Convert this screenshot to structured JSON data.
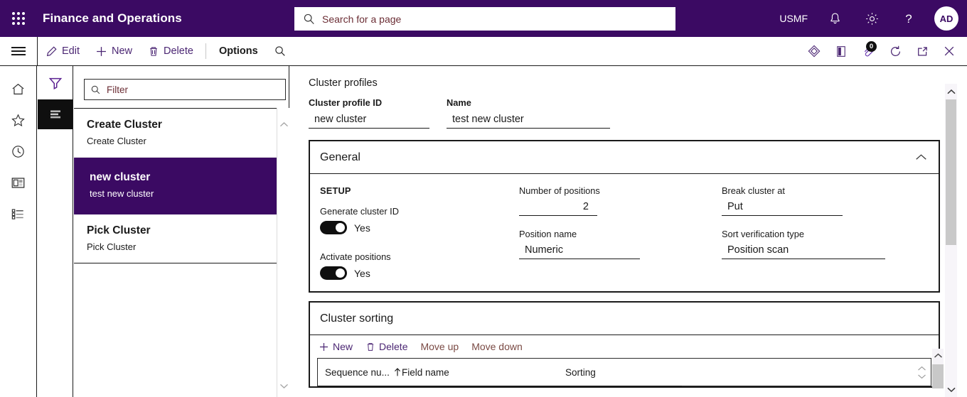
{
  "topbar": {
    "waffle_icon": "app-launcher-icon",
    "app_title": "Finance and Operations",
    "search": {
      "icon": "search-icon",
      "placeholder": "Search for a page",
      "value": ""
    },
    "company": "USMF",
    "icons": [
      "notifications-bell-icon",
      "settings-gear-icon",
      "help-question-icon"
    ],
    "avatar_initials": "AD"
  },
  "commandbar": {
    "menu_icon": "hamburger-menu-icon",
    "buttons": [
      {
        "label": "Edit",
        "icon": "pencil-icon"
      },
      {
        "label": "New",
        "icon": "plus-icon"
      },
      {
        "label": "Delete",
        "icon": "trash-icon"
      }
    ],
    "options_label": "Options",
    "search_icon": "search-icon",
    "right_icons": [
      {
        "name": "relationships-diamond-icon"
      },
      {
        "name": "office-app-icon"
      },
      {
        "name": "attachments-paperclip-icon",
        "badge": "0"
      },
      {
        "name": "refresh-icon"
      },
      {
        "name": "open-in-new-window-icon"
      },
      {
        "name": "close-icon"
      }
    ]
  },
  "rail": {
    "icons": [
      {
        "name": "home-icon"
      },
      {
        "name": "favorites-star-icon"
      },
      {
        "name": "recent-clock-icon"
      },
      {
        "name": "workspaces-icon"
      },
      {
        "name": "modules-list-icon"
      }
    ]
  },
  "rail2": {
    "filter_icon": "filter-funnel-icon",
    "list_icon": "list-view-icon"
  },
  "listpanel": {
    "filter": {
      "icon": "search-icon",
      "placeholder": "Filter",
      "value": ""
    },
    "items": [
      {
        "title": "Create Cluster",
        "subtitle": "Create Cluster",
        "selected": false
      },
      {
        "title": "new cluster",
        "subtitle": "test new cluster",
        "selected": true
      },
      {
        "title": "Pick Cluster",
        "subtitle": "Pick Cluster",
        "selected": false
      }
    ],
    "scroll_up_icon": "chevron-up-icon",
    "scroll_down_icon": "chevron-down-icon"
  },
  "main": {
    "page_caption": "Cluster profiles",
    "header_fields": [
      {
        "label": "Cluster profile ID",
        "value": "new cluster"
      },
      {
        "label": "Name",
        "value": "test new cluster"
      }
    ],
    "general": {
      "title": "General",
      "collapse_icon": "chevron-up-icon",
      "setup_label": "SETUP",
      "toggles": [
        {
          "label": "Generate cluster ID",
          "state": "Yes"
        },
        {
          "label": "Activate positions",
          "state": "Yes"
        }
      ],
      "fields_col2": [
        {
          "label": "Number of positions",
          "value": "2"
        },
        {
          "label": "Position name",
          "value": "Numeric"
        }
      ],
      "fields_col3": [
        {
          "label": "Break cluster at",
          "value": "Put"
        },
        {
          "label": "Sort verification type",
          "value": "Position scan"
        }
      ]
    },
    "cluster_sorting": {
      "title": "Cluster sorting",
      "toolbar": [
        {
          "label": "New",
          "icon": "plus-icon",
          "dim": false
        },
        {
          "label": "Delete",
          "icon": "trash-icon",
          "dim": false
        },
        {
          "label": "Move up",
          "icon": "",
          "dim": true
        },
        {
          "label": "Move down",
          "icon": "",
          "dim": true
        }
      ],
      "columns": [
        {
          "label": "Sequence nu...",
          "sort_icon": "sort-ascending-arrow-icon"
        },
        {
          "label": "Field name"
        },
        {
          "label": "Sorting"
        }
      ]
    }
  },
  "colors": {
    "brand_purple": "#3B0A63",
    "link_purple": "#4B2673",
    "dim_red": "#7a4a44",
    "placeholder_red": "#6b2d34"
  }
}
